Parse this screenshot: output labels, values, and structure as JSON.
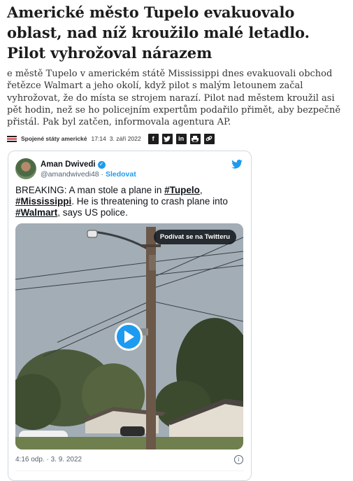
{
  "article": {
    "headline": "Americké město Tupelo evakuovalo oblast, nad níž kroužilo malé letadlo. Pilot vyhrožoval nárazem",
    "perex": "e městě Tupelo v americkém státě Mississippi dnes evakuovali obchod řetězce Walmart a jeho okolí, když pilot s malým letounem začal vyhrožovat, že do místa se strojem narazí. Pilot nad městem kroužil asi pět hodin, než se ho policejním expertům podařilo přimět, aby bezpečně přistál. Pak byl zatčen, informovala agentura AP.",
    "section": "Spojené státy americké",
    "time": "17:14",
    "date": "3. září 2022",
    "share_icons": [
      "facebook-icon",
      "twitter-icon",
      "linkedin-icon",
      "print-icon",
      "link-icon"
    ]
  },
  "tweet": {
    "author_name": "Aman Dwivedi",
    "handle": "@amandwivedi48",
    "separator": " · ",
    "follow_label": "Sledovat",
    "text_prefix": "BREAKING: A man stole a plane in ",
    "tag1": "#Tupelo",
    "text_comma": ", ",
    "tag2": "#Mississippi",
    "text_mid": ". He is threatening to crash plane into ",
    "tag3": "#Walmart",
    "text_suffix": ", says US police.",
    "watch_label": "Podívat se na Twitteru",
    "timestamp": "4:16 odp. · 3. 9. 2022",
    "info_glyph": "i"
  },
  "colors": {
    "accent": "#1d9bf0",
    "section_icon_red": "#d01f26"
  }
}
